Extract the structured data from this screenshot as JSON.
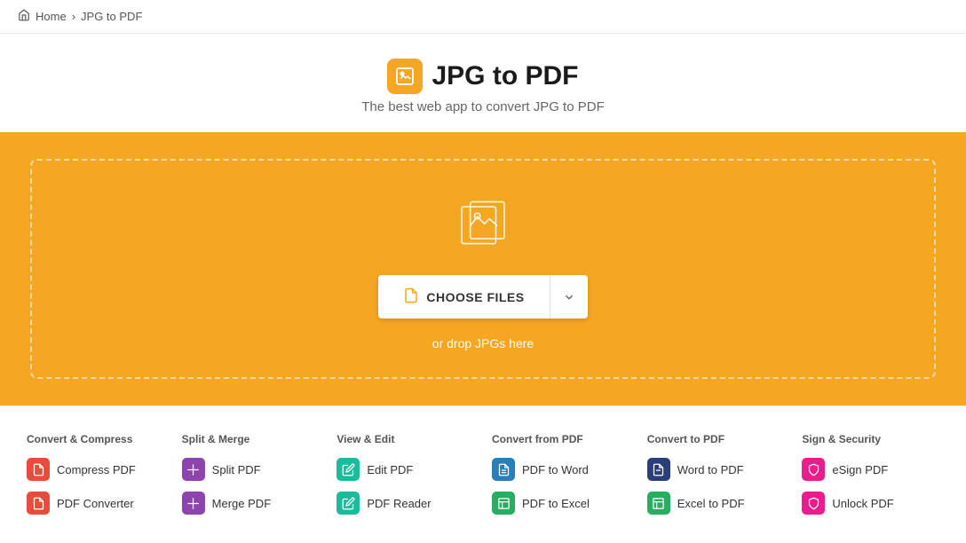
{
  "breadcrumb": {
    "home_label": "Home",
    "separator": "›",
    "current": "JPG to PDF"
  },
  "header": {
    "title": "JPG to PDF",
    "subtitle": "The best web app to convert JPG to PDF"
  },
  "dropzone": {
    "choose_files_label": "CHOOSE FILES",
    "drop_hint": "or drop JPGs here"
  },
  "tools": {
    "columns": [
      {
        "title": "Convert & Compress",
        "items": [
          {
            "label": "Compress PDF",
            "icon_color": "icon-red"
          },
          {
            "label": "PDF Converter",
            "icon_color": "icon-red"
          }
        ]
      },
      {
        "title": "Split & Merge",
        "items": [
          {
            "label": "Split PDF",
            "icon_color": "icon-purple"
          },
          {
            "label": "Merge PDF",
            "icon_color": "icon-purple"
          }
        ]
      },
      {
        "title": "View & Edit",
        "items": [
          {
            "label": "Edit PDF",
            "icon_color": "icon-teal"
          },
          {
            "label": "PDF Reader",
            "icon_color": "icon-teal"
          }
        ]
      },
      {
        "title": "Convert from PDF",
        "items": [
          {
            "label": "PDF to Word",
            "icon_color": "icon-blue"
          },
          {
            "label": "PDF to Excel",
            "icon_color": "icon-green"
          }
        ]
      },
      {
        "title": "Convert to PDF",
        "items": [
          {
            "label": "Word to PDF",
            "icon_color": "icon-dark-blue"
          },
          {
            "label": "Excel to PDF",
            "icon_color": "icon-green"
          }
        ]
      },
      {
        "title": "Sign & Security",
        "items": [
          {
            "label": "eSign PDF",
            "icon_color": "icon-pink"
          },
          {
            "label": "Unlock PDF",
            "icon_color": "icon-pink"
          }
        ]
      }
    ]
  },
  "colors": {
    "accent": "#f5a623"
  }
}
